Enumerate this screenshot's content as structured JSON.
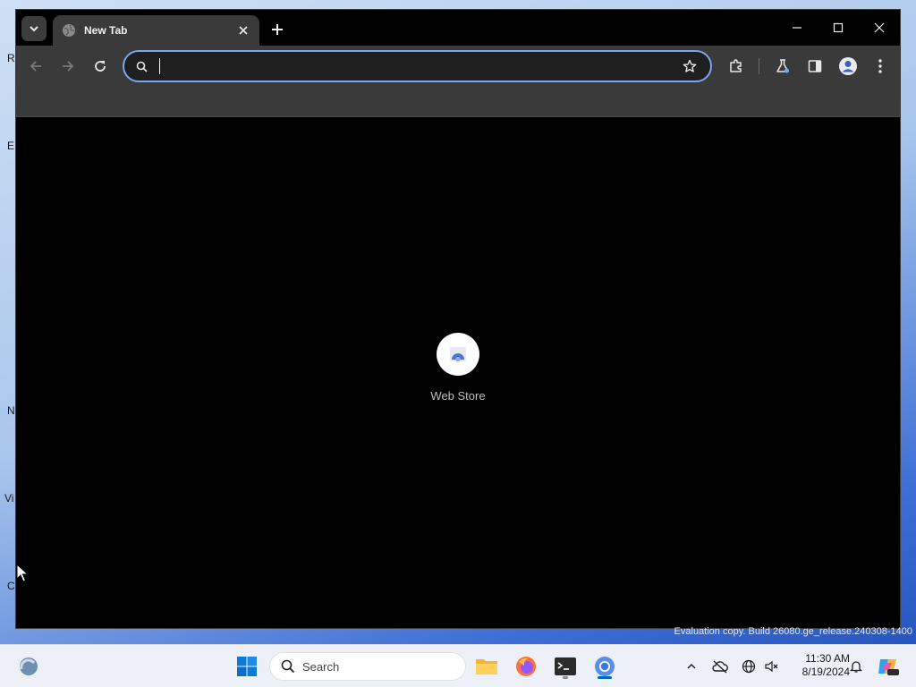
{
  "desktop": {
    "fragments": [
      "R",
      "E",
      "N",
      "Vi",
      "C"
    ]
  },
  "browser": {
    "tab": {
      "title": "New Tab"
    },
    "omnibox": {
      "value": "",
      "placeholder": ""
    },
    "shortcuts": [
      {
        "label": "Web Store"
      }
    ]
  },
  "watermark": "Evaluation copy. Build 26080.ge_release.240308-1400",
  "taskbar": {
    "search_label": "Search",
    "clock_time": "11:30 AM",
    "clock_date": "8/19/2024"
  },
  "colors": {
    "omnibox_focus": "#7ca6f2",
    "toolbar_bg": "#3a3a3a",
    "page_bg": "#000000",
    "windows_blue": "#0067c0"
  }
}
